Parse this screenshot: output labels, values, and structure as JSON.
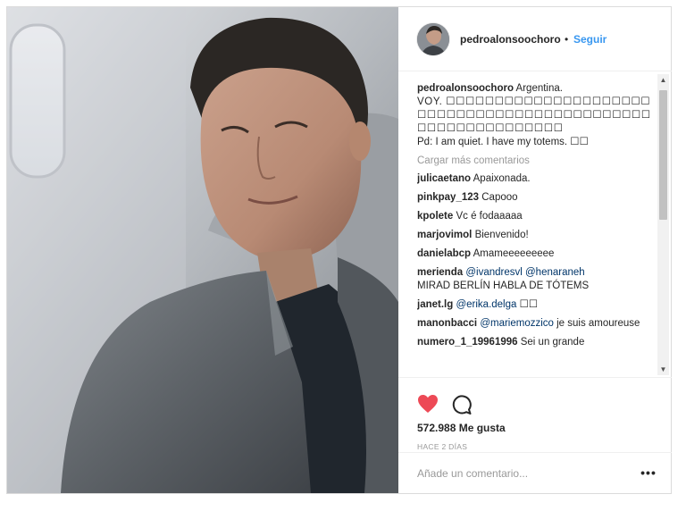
{
  "post": {
    "username": "pedroalonsoochoro",
    "dot": "•",
    "follow_label": "Seguir"
  },
  "caption": {
    "username": "pedroalonsoochoro",
    "line1": "Argentina.",
    "line2": "VOY. ☐☐☐☐☐☐☐☐☐☐☐☐☐☐☐☐☐☐☐☐☐☐☐☐☐☐☐☐☐☐☐☐☐☐☐☐☐☐☐☐☐☐☐☐☐☐☐☐☐☐☐☐☐☐☐☐☐☐☐☐",
    "line3": "Pd: I am quiet. I have my totems. ☐☐"
  },
  "load_more_label": "Cargar más comentarios",
  "comments": [
    {
      "user": "julicaetano",
      "text": "Apaixonada."
    },
    {
      "user": "pinkpay_123",
      "text": "Capooo"
    },
    {
      "user": "kpolete",
      "text": "Vc é fodaaaaa"
    },
    {
      "user": "marjovimol",
      "text": "Bienvenido!"
    },
    {
      "user": "danielabcp",
      "text": "Amameeeeeeeee"
    },
    {
      "user": "merienda",
      "mention1": "@ivandresvl",
      "mention2": "@henaraneh",
      "text": "MIRAD BERLÍN HABLA DE TÓTEMS"
    },
    {
      "user": "janet.lg",
      "mention1": "@erika.delga",
      "text": "☐☐"
    },
    {
      "user": "manonbacci",
      "mention1": "@mariemozzico",
      "text": "je suis amoureuse"
    },
    {
      "user": "numero_1_19961996",
      "text": "Sei un grande"
    }
  ],
  "actions": {
    "like_icon": "heart-icon",
    "comment_icon": "comment-icon",
    "like_color": "#ed4956",
    "likes_text": "572.988 Me gusta",
    "time_text": "HACE 2 DÍAS"
  },
  "add_comment": {
    "placeholder": "Añade un comentario...",
    "more_label": "•••"
  },
  "scrollbar": {
    "up_glyph": "▲",
    "down_glyph": "▼"
  }
}
